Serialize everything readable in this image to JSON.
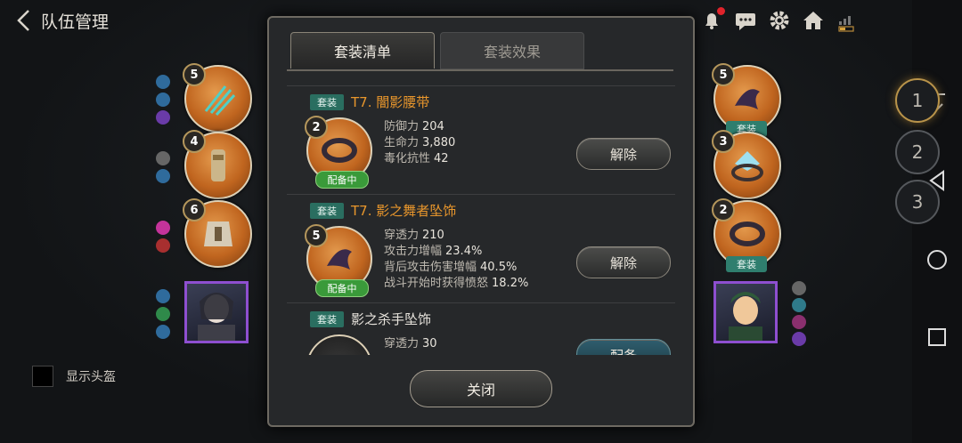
{
  "header": {
    "title": "队伍管理"
  },
  "team_numbers": [
    "1",
    "2",
    "3"
  ],
  "left_slots": [
    {
      "level": "5"
    },
    {
      "level": "4"
    },
    {
      "level": "6"
    }
  ],
  "right_slots": [
    {
      "level": "5",
      "tag": "套装"
    },
    {
      "level": "3"
    },
    {
      "level": "2",
      "tag": "套装"
    }
  ],
  "show_helmet": {
    "label": "显示头盔",
    "checked": false
  },
  "modal": {
    "tabs": [
      {
        "label": "套装清单",
        "active": true
      },
      {
        "label": "套装效果",
        "active": false
      }
    ],
    "items": [
      {
        "tag": "套装",
        "name": "T7. 闇影腰带",
        "level": "2",
        "status": "配备中",
        "stats": [
          {
            "k": "防御力",
            "v": "204"
          },
          {
            "k": "生命力",
            "v": "3,880"
          },
          {
            "k": "毒化抗性",
            "v": "42"
          }
        ],
        "action": "解除"
      },
      {
        "tag": "套装",
        "name": "T7. 影之舞者坠饰",
        "level": "5",
        "status": "配备中",
        "stats": [
          {
            "k": "穿透力",
            "v": "210"
          },
          {
            "k": "攻击力增幅",
            "v": "23.4%"
          },
          {
            "k": "背后攻击伤害增幅",
            "v": "40.5%"
          },
          {
            "k": "战斗开始时获得愤怒",
            "v": "18.2%"
          }
        ],
        "action": "解除"
      },
      {
        "tag": "套装",
        "name": "影之杀手坠饰",
        "stats": [
          {
            "k": "穿透力",
            "v": "30"
          }
        ],
        "action": "配备"
      }
    ],
    "close_label": "关闭"
  },
  "colors": {
    "accent_orange": "#e8962c",
    "set_tag": "#2a6e60",
    "equipped_green": "#3a9a3a"
  }
}
